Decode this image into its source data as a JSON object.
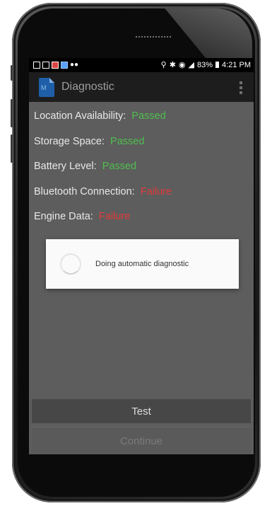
{
  "status_bar": {
    "icons": [
      "image-icon",
      "photo-icon",
      "calendar-icon",
      "app-icon",
      "voicemail-icon"
    ],
    "right_icons": [
      "location-icon",
      "bluetooth-icon",
      "wifi-icon",
      "signal-icon",
      "battery-icon"
    ],
    "battery": "83%",
    "time": "4:21 PM"
  },
  "app_bar": {
    "icon_text": "M",
    "title": "Diagnostic"
  },
  "diagnostics": [
    {
      "label": "Location Availability:",
      "status": "Passed"
    },
    {
      "label": "Storage Space:",
      "status": "Passed"
    },
    {
      "label": "Battery Level:",
      "status": "Passed"
    },
    {
      "label": "Bluetooth Connection:",
      "status": "Failure"
    },
    {
      "label": "Engine Data:",
      "status": "Failure"
    }
  ],
  "dialog": {
    "message": "Doing automatic diagnostic"
  },
  "buttons": {
    "test": "Test",
    "continue": "Continue"
  },
  "colors": {
    "passed": "#4fbe4f",
    "failure": "#e23a3a",
    "screen_bg": "#5d5d5d",
    "app_bar": "#1d1d1d"
  }
}
